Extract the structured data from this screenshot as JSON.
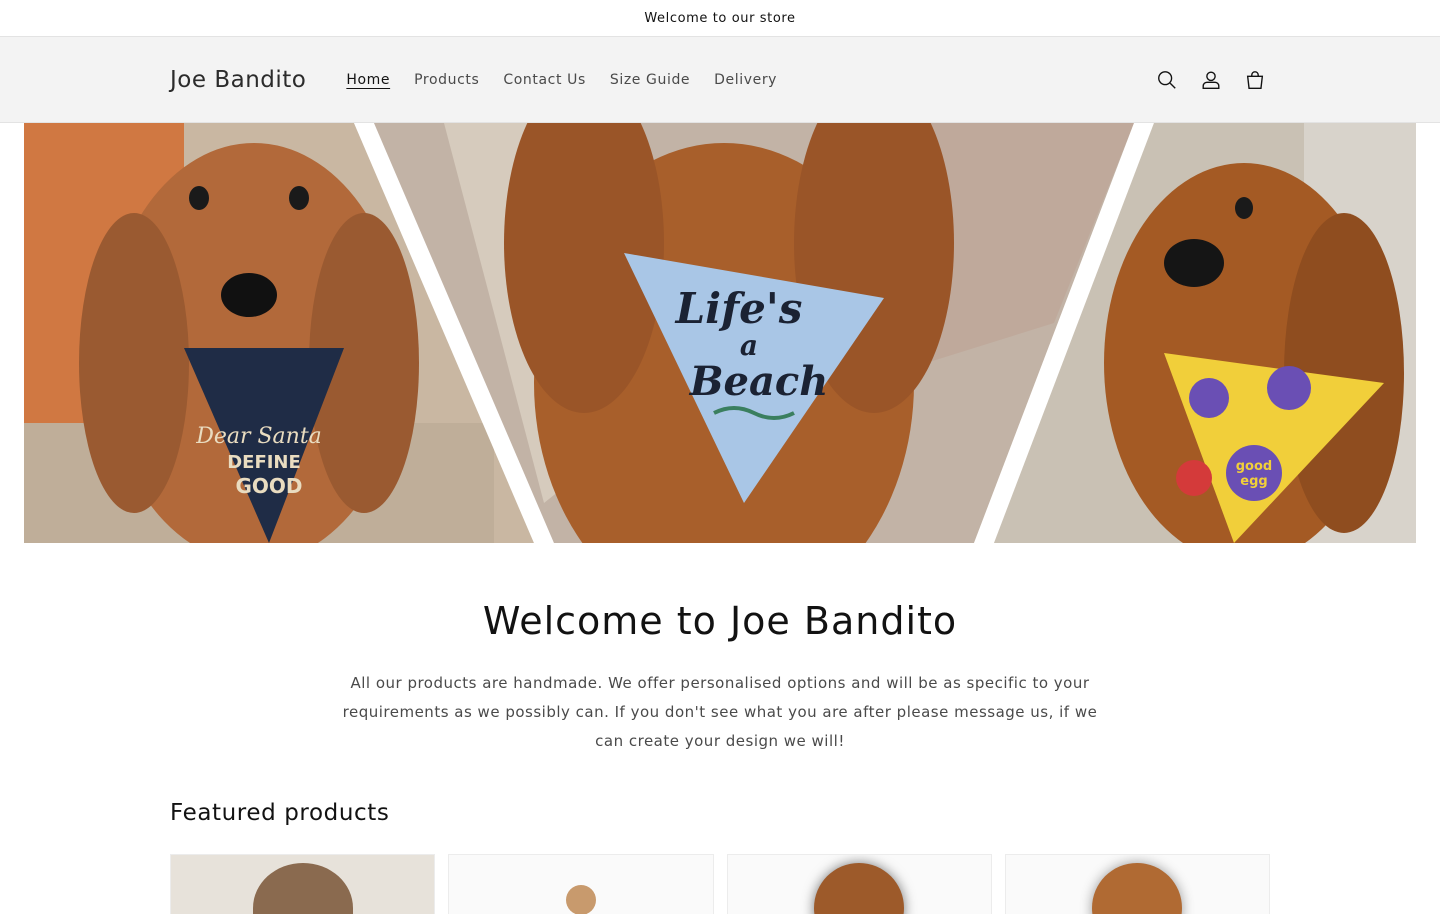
{
  "announcement": {
    "text": "Welcome to our store"
  },
  "header": {
    "logo": "Joe Bandito",
    "nav": [
      {
        "label": "Home",
        "active": true
      },
      {
        "label": "Products",
        "active": false
      },
      {
        "label": "Contact Us",
        "active": false
      },
      {
        "label": "Size Guide",
        "active": false
      },
      {
        "label": "Delivery",
        "active": false
      }
    ],
    "icons": [
      "search-icon",
      "account-icon",
      "cart-icon"
    ]
  },
  "hero": {
    "bandanas": [
      {
        "text_line1": "Dear Santa",
        "text_line2": "DEFINE",
        "text_line3": "GOOD"
      },
      {
        "text_line1": "Life's",
        "text_line2": "a",
        "text_line3": "Beach"
      },
      {
        "text_line1": "good",
        "text_line2": "egg",
        "text_line3": ""
      }
    ]
  },
  "welcome": {
    "title": "Welcome to Joe Bandito",
    "body": "All our products are handmade. We offer personalised options and will be as specific to your requirements as we possibly can. If you don't see what you are after please message us, if we can create your design we will!"
  },
  "featured": {
    "title": "Featured products",
    "cards": [
      {
        "image_name": "bulldog-bandana-image"
      },
      {
        "image_name": "spaniel-bandana-image-1"
      },
      {
        "image_name": "spaniel-bandana-image-2"
      },
      {
        "image_name": "spaniel-bandana-image-3"
      }
    ]
  },
  "colors": {
    "header_bg": "#f3f3f3",
    "text": "#121212",
    "muted": "#4a4a4a",
    "dog_fur": "#b9713f",
    "bandana_navy": "#1f2c46",
    "bandana_blue": "#a9c6e6",
    "bandana_yellow": "#f1cf3a"
  }
}
